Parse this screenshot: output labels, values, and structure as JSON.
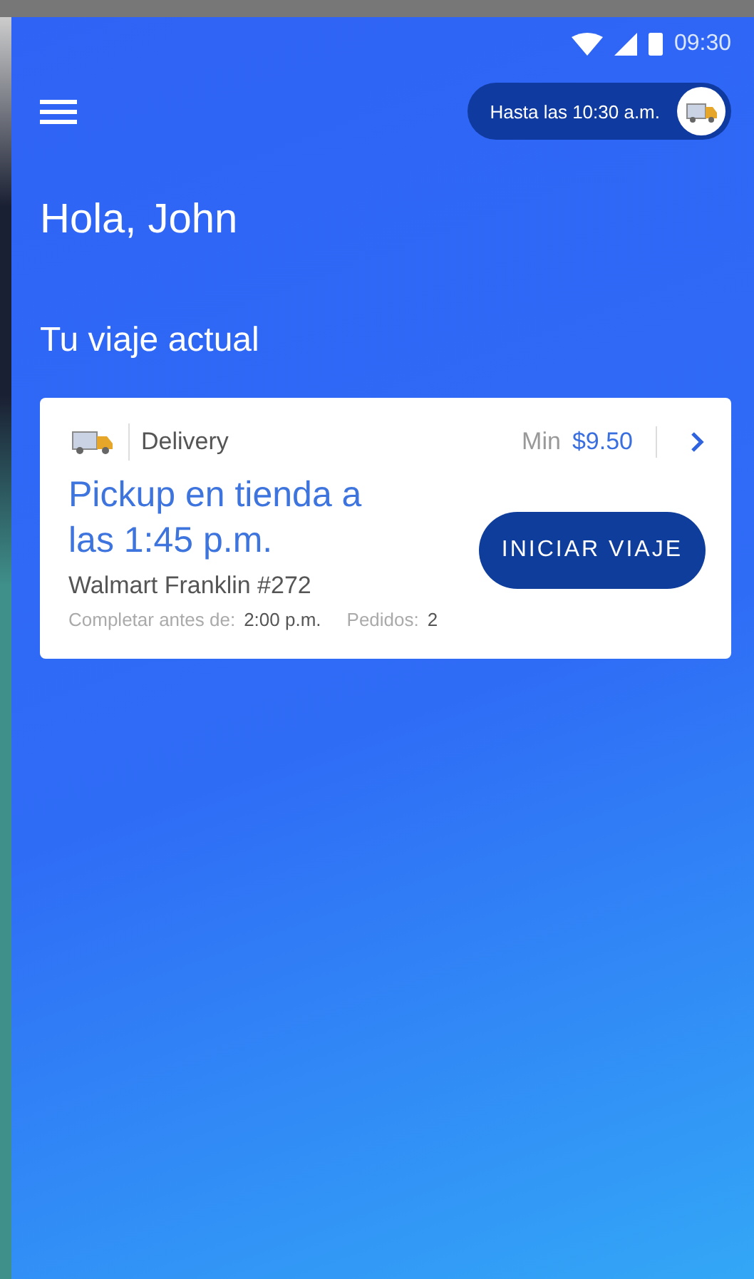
{
  "status_bar": {
    "time": "09:30"
  },
  "header": {
    "shift_pill": "Hasta las 10:30 a.m."
  },
  "greeting": "Hola, John",
  "section_title": "Tu viaje actual",
  "trip_card": {
    "type": "Delivery",
    "min_label": "Min",
    "min_pay": "$9.50",
    "title": "Pickup en tienda a las 1:45 p.m.",
    "store": "Walmart Franklin #272",
    "deadline_label": "Completar antes de:",
    "deadline": "2:00 p.m.",
    "orders_label": "Pedidos:",
    "orders": "2",
    "button": "INICIAR VIAJE"
  }
}
